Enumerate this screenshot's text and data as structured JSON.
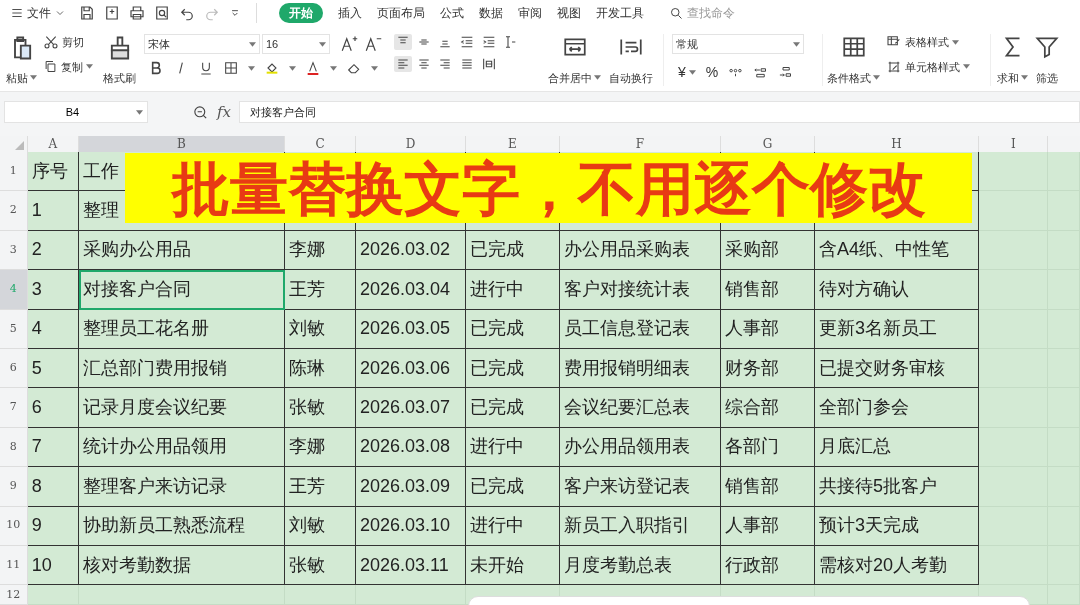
{
  "menu_bar": {
    "file_menu": "文件",
    "tabs": [
      {
        "label": "开始",
        "selected": true
      },
      {
        "label": "插入",
        "selected": false
      },
      {
        "label": "页面布局",
        "selected": false
      },
      {
        "label": "公式",
        "selected": false
      },
      {
        "label": "数据",
        "selected": false
      },
      {
        "label": "审阅",
        "selected": false
      },
      {
        "label": "视图",
        "selected": false
      },
      {
        "label": "开发工具",
        "selected": false
      }
    ],
    "search": {
      "placeholder": "查找命令"
    }
  },
  "ribbon": {
    "paste": "粘贴",
    "cut": "剪切",
    "copy": "复制",
    "format_painter": "格式刷",
    "font_name": "宋体",
    "font_size": "16",
    "merge_center": "合并居中",
    "wrap_text": "自动换行",
    "number_format": "常规",
    "currency": "¥",
    "percent": "%",
    "conditional_format": "条件格式",
    "table_style": "表格样式",
    "cell_style": "单元格样式",
    "sum": "求和",
    "filter": "筛选"
  },
  "formula_bar": {
    "name_box": "B4",
    "function_label": "fx",
    "formula": "对接客户合同"
  },
  "columns": [
    {
      "label": "A",
      "selected": false
    },
    {
      "label": "B",
      "selected": true
    },
    {
      "label": "C",
      "selected": false
    },
    {
      "label": "D",
      "selected": false
    },
    {
      "label": "E",
      "selected": false
    },
    {
      "label": "F",
      "selected": false
    },
    {
      "label": "G",
      "selected": false
    },
    {
      "label": "H",
      "selected": false
    },
    {
      "label": "I",
      "selected": false
    }
  ],
  "rows": [
    {
      "number": "1",
      "selected": false,
      "cells": [
        "序号",
        "工作"
      ]
    },
    {
      "number": "2",
      "selected": false,
      "cells": [
        "1",
        "整理"
      ]
    },
    {
      "number": "3",
      "selected": false,
      "cells": [
        "2",
        "采购办公用品",
        "李娜",
        "2026.03.02",
        "已完成",
        "办公用品采购表",
        "采购部",
        "含A4纸、中性笔"
      ]
    },
    {
      "number": "4",
      "selected": true,
      "cells": [
        "3",
        "对接客户合同",
        "王芳",
        "2026.03.04",
        "进行中",
        "客户对接统计表",
        "销售部",
        "待对方确认"
      ]
    },
    {
      "number": "5",
      "selected": false,
      "cells": [
        "4",
        "整理员工花名册",
        "刘敏",
        "2026.03.05",
        "已完成",
        "员工信息登记表",
        "人事部",
        "更新3名新员工"
      ]
    },
    {
      "number": "6",
      "selected": false,
      "cells": [
        "5",
        "汇总部门费用报销",
        "陈琳",
        "2026.03.06",
        "已完成",
        "费用报销明细表",
        "财务部",
        "已提交财务审核"
      ]
    },
    {
      "number": "7",
      "selected": false,
      "cells": [
        "6",
        "记录月度会议纪要",
        "张敏",
        "2026.03.07",
        "已完成",
        "会议纪要汇总表",
        "综合部",
        "全部门参会"
      ]
    },
    {
      "number": "8",
      "selected": false,
      "cells": [
        "7",
        "统计办公用品领用",
        "李娜",
        "2026.03.08",
        "进行中",
        "办公用品领用表",
        "各部门",
        "月底汇总"
      ]
    },
    {
      "number": "9",
      "selected": false,
      "cells": [
        "8",
        "整理客户来访记录",
        "王芳",
        "2026.03.09",
        "已完成",
        "客户来访登记表",
        "销售部",
        "共接待5批客户"
      ]
    },
    {
      "number": "10",
      "selected": false,
      "cells": [
        "9",
        "协助新员工熟悉流程",
        "刘敏",
        "2026.03.10",
        "进行中",
        "新员工入职指引",
        "人事部",
        "预计3天完成"
      ]
    },
    {
      "number": "11",
      "selected": false,
      "cells": [
        "10",
        "核对考勤数据",
        "张敏",
        "2026.03.11",
        "未开始",
        "月度考勤总表",
        "行政部",
        "需核对20人考勤"
      ]
    },
    {
      "number": "12",
      "selected": false,
      "cells": []
    }
  ],
  "banner": "批量替换文字，不用逐个修改"
}
